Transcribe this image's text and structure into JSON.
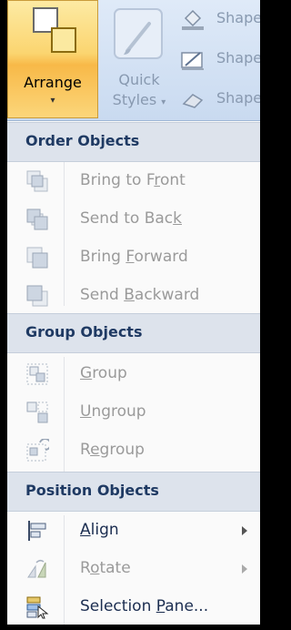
{
  "ribbon": {
    "arrange_label": "Arrange",
    "arrange_caret": "▾",
    "quick_styles_label_1": "Quick",
    "quick_styles_label_2": "Styles",
    "quick_styles_caret": "▾",
    "shape_fill_label": "Shape",
    "shape_outline_label": "Shape",
    "shape_effects_label": "Shape"
  },
  "menu": {
    "order_header": "Order Objects",
    "group_header": "Group Objects",
    "position_header": "Position Objects",
    "bring_to_front": {
      "before": "Bring to F",
      "key": "r",
      "after": "ont"
    },
    "send_to_back": {
      "before": "Send to Bac",
      "key": "k",
      "after": ""
    },
    "bring_forward": {
      "before": "Bring ",
      "key": "F",
      "after": "orward"
    },
    "send_backward": {
      "before": "Send ",
      "key": "B",
      "after": "ackward"
    },
    "group": {
      "before": "",
      "key": "G",
      "after": "roup"
    },
    "ungroup": {
      "before": "",
      "key": "U",
      "after": "ngroup"
    },
    "regroup": {
      "before": "R",
      "key": "e",
      "after": "group"
    },
    "align": {
      "before": "",
      "key": "A",
      "after": "lign"
    },
    "rotate": {
      "before": "R",
      "key": "o",
      "after": "tate"
    },
    "selection_pane": {
      "before": "Selection ",
      "key": "P",
      "after": "ane..."
    }
  },
  "colors": {
    "header_bg": "#dde3ec",
    "enabled_text": "#1b2d50",
    "disabled_text": "#9a9a9a",
    "arrange_highlight": "#fbd570"
  },
  "icons": {
    "arrange": "arrange-icon",
    "quick_styles": "paintbrush-icon",
    "shape_fill": "paint-bucket-icon",
    "shape_outline": "pencil-icon",
    "shape_effects": "eraser-icon"
  }
}
